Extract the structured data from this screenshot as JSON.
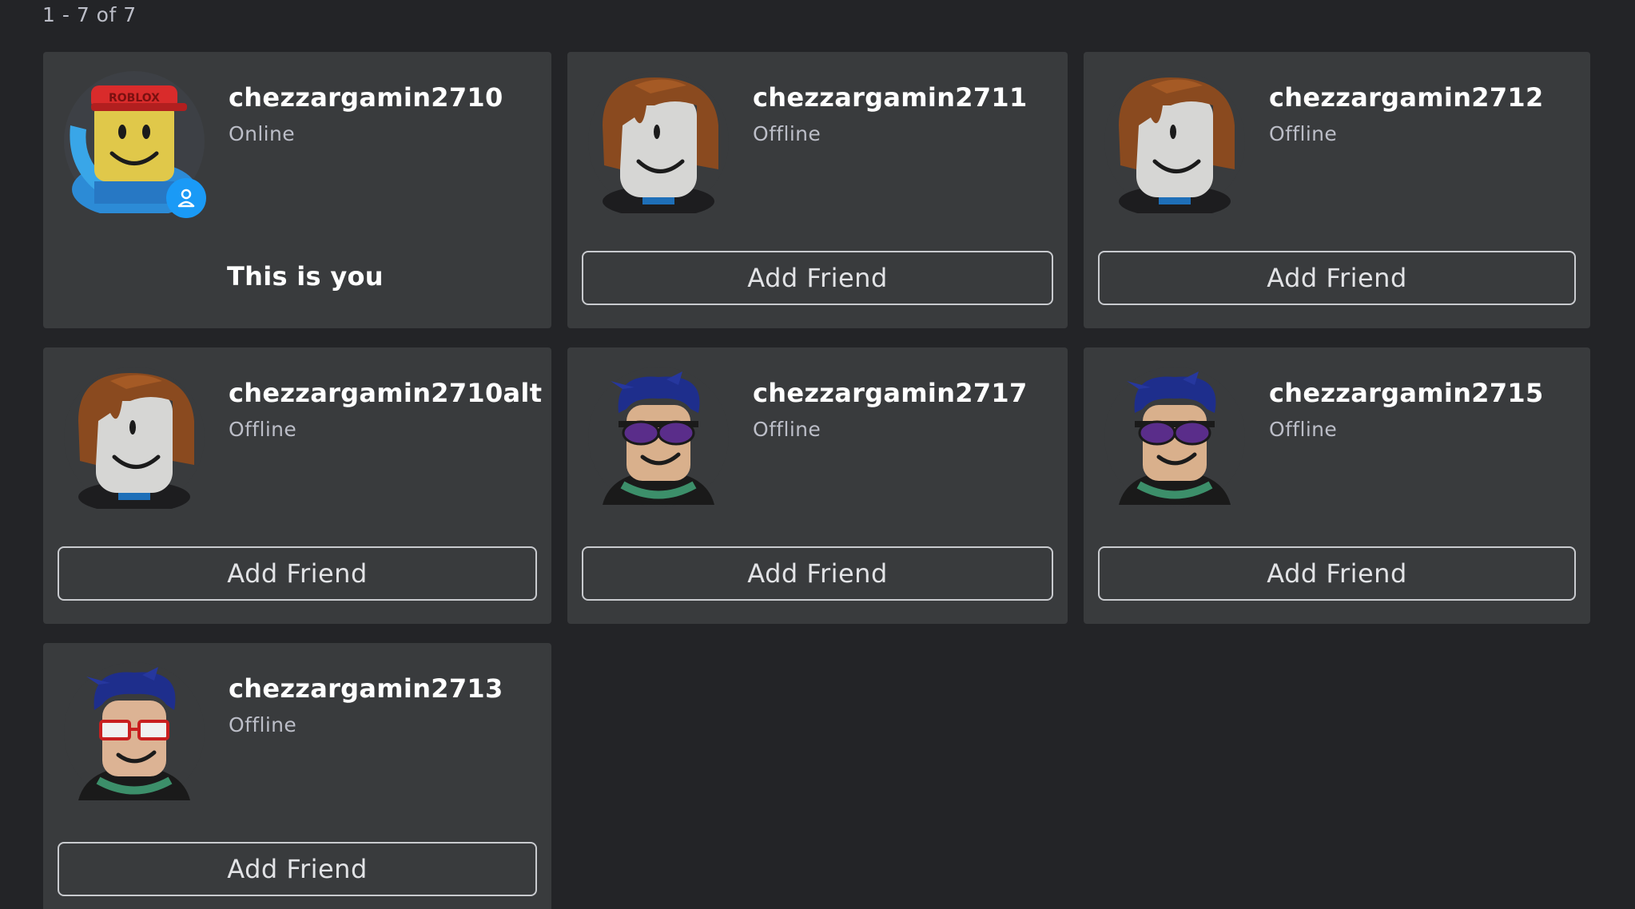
{
  "results_count": "1 - 7 of 7",
  "self_card": {
    "username": "chezzargamin2710",
    "status": "Online",
    "self_label": "This is you",
    "avatar_icon": "roblox-noob-avatar",
    "badge_icon": "user-icon"
  },
  "users": [
    {
      "username": "chezzargamin2711",
      "status": "Offline",
      "button": "Add Friend",
      "avatar": "brown-hair-bacon-avatar"
    },
    {
      "username": "chezzargamin2712",
      "status": "Offline",
      "button": "Add Friend",
      "avatar": "brown-hair-bacon-avatar"
    },
    {
      "username": "chezzargamin2710alt",
      "status": "Offline",
      "button": "Add Friend",
      "avatar": "brown-hair-bacon-avatar"
    },
    {
      "username": "chezzargamin2717",
      "status": "Offline",
      "button": "Add Friend",
      "avatar": "blue-hair-sunglasses-avatar"
    },
    {
      "username": "chezzargamin2715",
      "status": "Offline",
      "button": "Add Friend",
      "avatar": "blue-hair-sunglasses-avatar"
    },
    {
      "username": "chezzargamin2713",
      "status": "Offline",
      "button": "Add Friend",
      "avatar": "blue-hair-red-glasses-avatar"
    }
  ],
  "colors": {
    "background": "#232427",
    "card": "#393b3d",
    "badge": "#1a9af6"
  }
}
